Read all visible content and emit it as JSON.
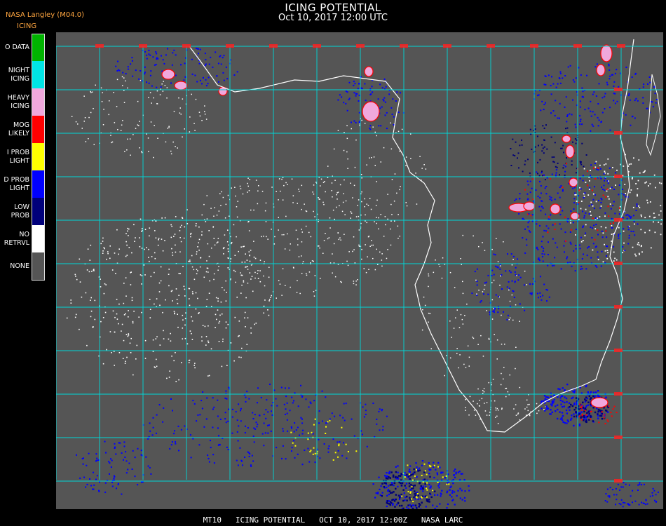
{
  "header": {
    "source": "NASA Langley (M04.0)",
    "product": "ICING",
    "title": "ICING POTENTIAL",
    "datetime": "Oct 10, 2017 12:00 UTC"
  },
  "legend": [
    {
      "lines": [
        "O DATA"
      ],
      "color": "#00b400"
    },
    {
      "lines": [
        "NIGHT",
        "ICING"
      ],
      "color": "#00e5e5"
    },
    {
      "lines": [
        "HEAVY",
        "ICING"
      ],
      "color": "#f0a8dc"
    },
    {
      "lines": [
        "MOG",
        "LIKELY"
      ],
      "color": "#ff0000"
    },
    {
      "lines": [
        "I PROB",
        "LIGHT"
      ],
      "color": "#ffff00"
    },
    {
      "lines": [
        "D PROB",
        "LIGHT"
      ],
      "color": "#0000ff"
    },
    {
      "lines": [
        "LOW",
        "PROB"
      ],
      "color": "#00007a"
    },
    {
      "lines": [
        "NO",
        "RETRVL"
      ],
      "color": "#ffffff"
    },
    {
      "lines": [
        "NONE"
      ],
      "color": "#555555"
    }
  ],
  "map": {
    "background": "#555555",
    "gridColor": "#00d8d8",
    "labelColor": "#ff2020"
  },
  "footer": "MT10   ICING POTENTIAL   OCT 10, 2017 12:00Z   NASA LARC"
}
